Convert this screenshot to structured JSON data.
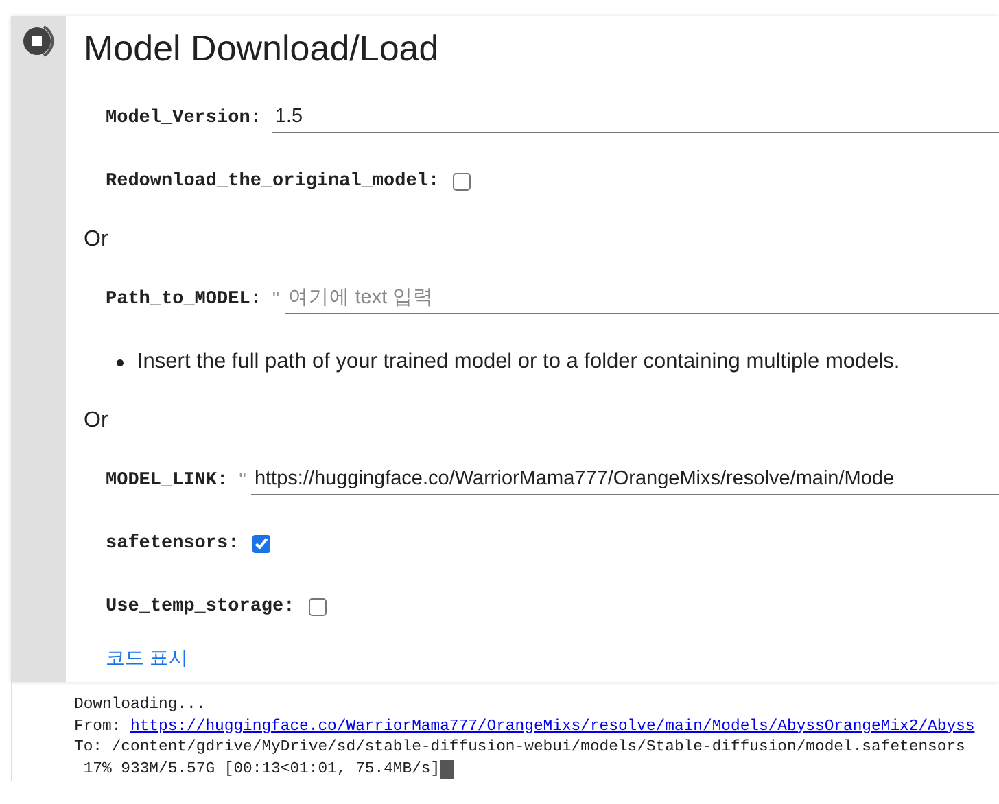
{
  "cell": {
    "title": "Model Download/Load",
    "params": [
      {
        "kind": "text",
        "label": "Model_Version:",
        "value": "1.5"
      },
      {
        "kind": "checkbox",
        "label": "Redownload_the_original_model:",
        "checked": false
      },
      {
        "kind": "note",
        "text": "Or"
      },
      {
        "kind": "text",
        "label": "Path_to_MODEL:",
        "quote": "\"",
        "placeholder": "여기에 text 입력"
      },
      {
        "kind": "bullet",
        "text": "Insert the full path of your trained model or to a folder containing multiple models."
      },
      {
        "kind": "note",
        "text": "Or"
      },
      {
        "kind": "text",
        "label": "MODEL_LINK:",
        "quote": "\"",
        "value": "https://huggingface.co/WarriorMama777/OrangeMixs/resolve/main/Mode"
      },
      {
        "kind": "checkbox",
        "label": "safetensors:",
        "checked": true
      },
      {
        "kind": "checkbox",
        "label": "Use_temp_storage:",
        "checked": false
      }
    ],
    "show_code_link": "코드 표시"
  },
  "output": {
    "lines": [
      {
        "kind": "plain",
        "text": "Downloading..."
      },
      {
        "kind": "link",
        "prefix": "From: ",
        "link": "https://huggingface.co/WarriorMama777/OrangeMixs/resolve/main/Models/AbyssOrangeMix2/Abyss"
      },
      {
        "kind": "plain",
        "text": "To: /content/gdrive/MyDrive/sd/stable-diffusion-webui/models/Stable-diffusion/model.safetensors"
      },
      {
        "kind": "progress",
        "text": " 17% 933M/5.57G [00:13<01:01, 75.4MB/s]"
      }
    ]
  }
}
